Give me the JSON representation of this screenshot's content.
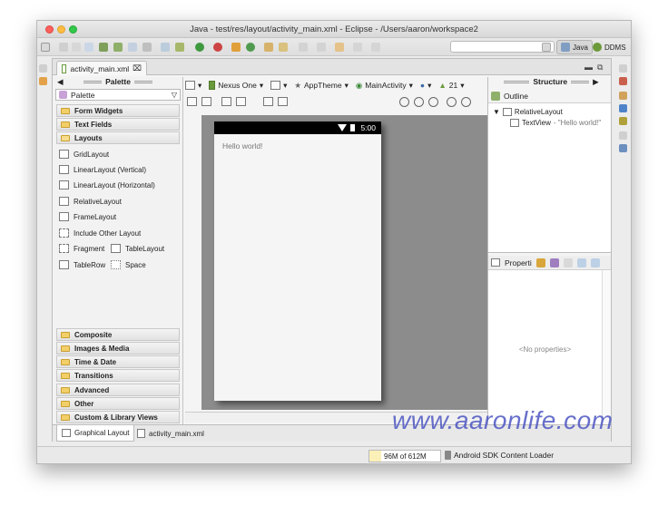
{
  "window": {
    "title": "Java - test/res/layout/activity_main.xml - Eclipse - /Users/aaron/workspace2"
  },
  "perspectives": {
    "java_label": "Java",
    "ddms_label": "DDMS"
  },
  "editor": {
    "tab_label": "activity_main.xml",
    "tab_close": "⌧"
  },
  "palette": {
    "header": "Palette",
    "selector": "Palette",
    "categories_top": [
      {
        "label": "Form Widgets"
      },
      {
        "label": "Text Fields"
      },
      {
        "label": "Layouts"
      }
    ],
    "layout_items": {
      "grid": "GridLayout",
      "linear_v": "LinearLayout (Vertical)",
      "linear_h": "LinearLayout (Horizontal)",
      "relative": "RelativeLayout",
      "frame": "FrameLayout",
      "include": "Include Other Layout",
      "fragment": "Fragment",
      "table_layout": "TableLayout",
      "table_row": "TableRow",
      "space": "Space"
    },
    "categories_bottom": [
      {
        "label": "Composite"
      },
      {
        "label": "Images & Media"
      },
      {
        "label": "Time & Date"
      },
      {
        "label": "Transitions"
      },
      {
        "label": "Advanced"
      },
      {
        "label": "Other"
      },
      {
        "label": "Custom & Library Views"
      }
    ]
  },
  "canvas_toolbar": {
    "device": "Nexus One",
    "theme": "AppTheme",
    "activity": "MainActivity",
    "api": "21"
  },
  "device": {
    "time": "5:00",
    "hello_text": "Hello world!"
  },
  "bottom_tabs": {
    "graphical": "Graphical Layout",
    "xml": "activity_main.xml"
  },
  "structure": {
    "header": "Structure",
    "outline_label": "Outline",
    "tree_root": "RelativeLayout",
    "tree_child": "TextView",
    "tree_child_detail": " - \"Hello world!\"",
    "properties_label": "Properti",
    "no_properties": "<No properties>"
  },
  "status": {
    "heap": "96M of 612M",
    "loader": "Android SDK Content Loader"
  },
  "watermark": "www.aaronlife.com",
  "colors": {
    "accent_green": "#6a9a3c",
    "watermark_blue": "#4d57c2"
  }
}
